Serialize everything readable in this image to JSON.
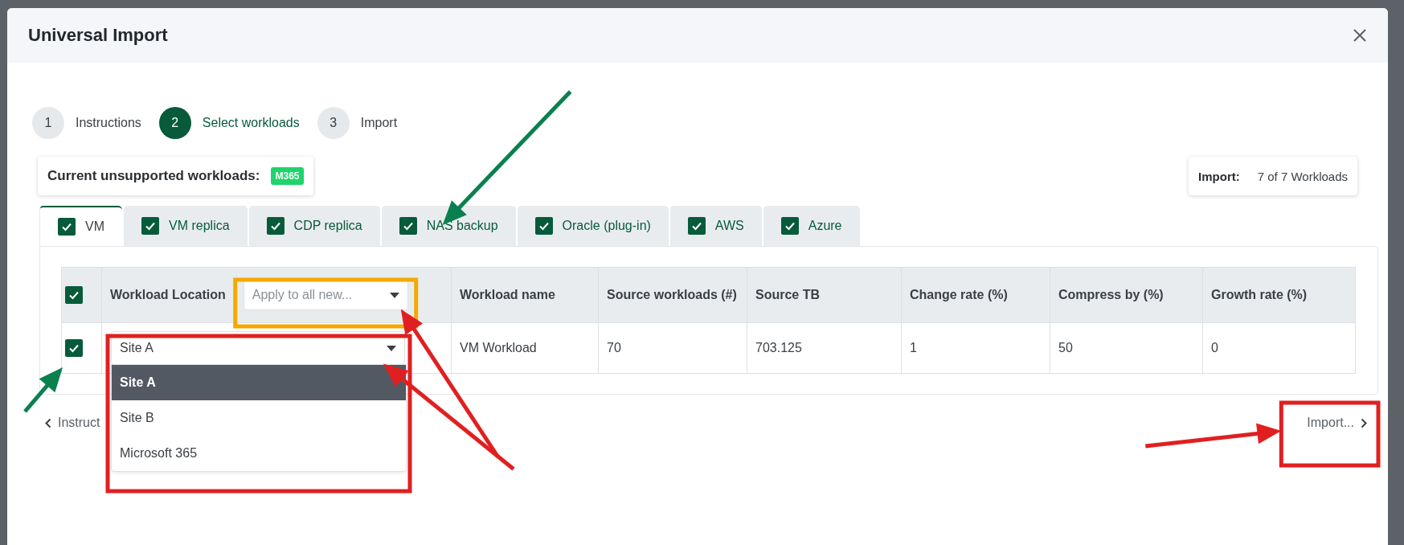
{
  "dialog": {
    "title": "Universal Import"
  },
  "steps": [
    {
      "number": "1",
      "label": "Instructions",
      "selected": false
    },
    {
      "number": "2",
      "label": "Select workloads",
      "selected": true
    },
    {
      "number": "3",
      "label": "Import",
      "selected": false
    }
  ],
  "unsupported": {
    "label": "Current unsupported workloads:",
    "badges": [
      "M365"
    ]
  },
  "import_summary": {
    "label": "Import:",
    "value": "7 of 7 Workloads"
  },
  "tabs": [
    {
      "label": "VM",
      "checked": true,
      "selected": true
    },
    {
      "label": "VM replica",
      "checked": true,
      "selected": false
    },
    {
      "label": "CDP replica",
      "checked": true,
      "selected": false
    },
    {
      "label": "NAS backup",
      "checked": true,
      "selected": false
    },
    {
      "label": "Oracle (plug-in)",
      "checked": true,
      "selected": false
    },
    {
      "label": "AWS",
      "checked": true,
      "selected": false
    },
    {
      "label": "Azure",
      "checked": true,
      "selected": false
    }
  ],
  "table": {
    "select_all_checked": true,
    "columns": [
      "Workload Location",
      "Workload name",
      "Source workloads (#)",
      "Source TB",
      "Change rate (%)",
      "Compress by (%)",
      "Growth rate (%)"
    ],
    "apply_all": {
      "placeholder": "Apply to all new..."
    },
    "rows": [
      {
        "checked": true,
        "cells": [
          "Site A",
          "VM Workload",
          "70",
          "703.125",
          "1",
          "50",
          "0"
        ]
      }
    ]
  },
  "location_menu": {
    "options": [
      {
        "label": "Site A",
        "selected": true
      },
      {
        "label": "Site B",
        "selected": false
      },
      {
        "label": "Microsoft 365",
        "selected": false
      }
    ]
  },
  "nav": {
    "back": "Instruct",
    "next": "Import..."
  },
  "annotations": [
    {
      "kind": "box",
      "color": "#f5a800"
    },
    {
      "kind": "box",
      "color": "#e02020"
    },
    {
      "kind": "box",
      "color": "#e02020"
    },
    {
      "kind": "arrow",
      "color": "#e02020"
    },
    {
      "kind": "arrow",
      "color": "#e02020"
    },
    {
      "kind": "arrow",
      "color": "#e02020"
    },
    {
      "kind": "arrow",
      "color": "#0a8050"
    },
    {
      "kind": "arrow",
      "color": "#0a8050"
    }
  ]
}
